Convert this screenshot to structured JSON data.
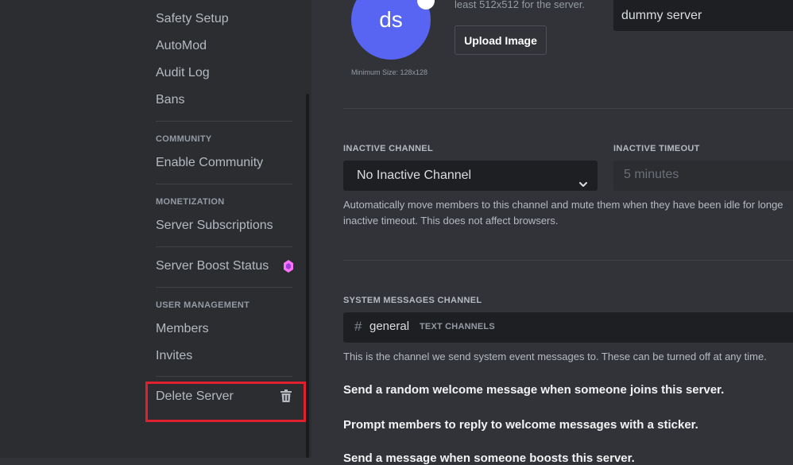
{
  "sidebar": {
    "items": {
      "safety_setup": "Safety Setup",
      "automod": "AutoMod",
      "audit_log": "Audit Log",
      "bans": "Bans",
      "enable_community": "Enable Community",
      "server_subscriptions": "Server Subscriptions",
      "server_boost_status": "Server Boost Status",
      "members": "Members",
      "invites": "Invites",
      "delete_server": "Delete Server"
    },
    "headers": {
      "community": "COMMUNITY",
      "monetization": "MONETIZATION",
      "user_management": "USER MANAGEMENT"
    }
  },
  "overview": {
    "avatar_initials": "ds",
    "min_size_text": "Minimum Size: 128x128",
    "upload_hint": "least 512x512 for the server.",
    "upload_button": "Upload Image",
    "server_name_value": "dummy server"
  },
  "inactive": {
    "channel_label": "INACTIVE CHANNEL",
    "channel_value": "No Inactive Channel",
    "timeout_label": "INACTIVE TIMEOUT",
    "timeout_value": "5 minutes",
    "help_line1": "Automatically move members to this channel and mute them when they have been idle for longe",
    "help_line2": "inactive timeout. This does not affect browsers."
  },
  "system_messages": {
    "label": "SYSTEM MESSAGES CHANNEL",
    "channel_name": "general",
    "channel_category": "TEXT CHANNELS",
    "help": "This is the channel we send system event messages to. These can be turned off at any time.",
    "toggle_welcome": "Send a random welcome message when someone joins this server.",
    "toggle_sticker": "Prompt members to reply to welcome messages with a sticker.",
    "toggle_boost": "Send a message when someone boosts this server."
  },
  "colors": {
    "accent": "#5865f2",
    "highlight_border": "#e0202e",
    "boost_gem": "#ff73fa"
  },
  "icons": {
    "boost": "boost-gem-icon",
    "delete": "trash-icon",
    "select": "chevron-down-icon",
    "channel": "hashtag-icon"
  }
}
